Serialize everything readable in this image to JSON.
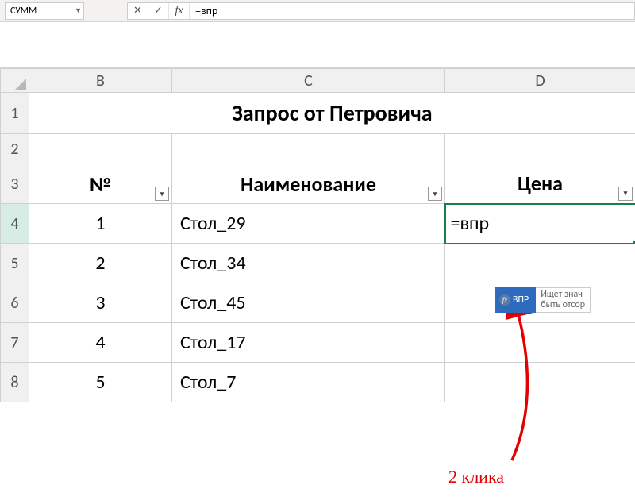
{
  "nameBox": "СУММ",
  "formulaBar": {
    "cancel": "✕",
    "confirm": "✓",
    "fx": "fx",
    "content": "=впр"
  },
  "columns": [
    "B",
    "C",
    "D"
  ],
  "rows": [
    "1",
    "2",
    "3",
    "4",
    "5",
    "6",
    "7",
    "8"
  ],
  "title": "Запрос от Петровича",
  "headers": {
    "num": "№",
    "name": "Наименование",
    "price": "Цена"
  },
  "data": [
    {
      "num": "1",
      "name": "Стол_29"
    },
    {
      "num": "2",
      "name": "Стол_34"
    },
    {
      "num": "3",
      "name": "Стол_45"
    },
    {
      "num": "4",
      "name": "Стол_17"
    },
    {
      "num": "5",
      "name": "Стол_7"
    }
  ],
  "activeFormula": "=впр",
  "autocomplete": {
    "fxBadge": "fx",
    "fn": "ВПР",
    "desc": "Ищет знач\nбыть отсор"
  },
  "annotation": "2 клика"
}
